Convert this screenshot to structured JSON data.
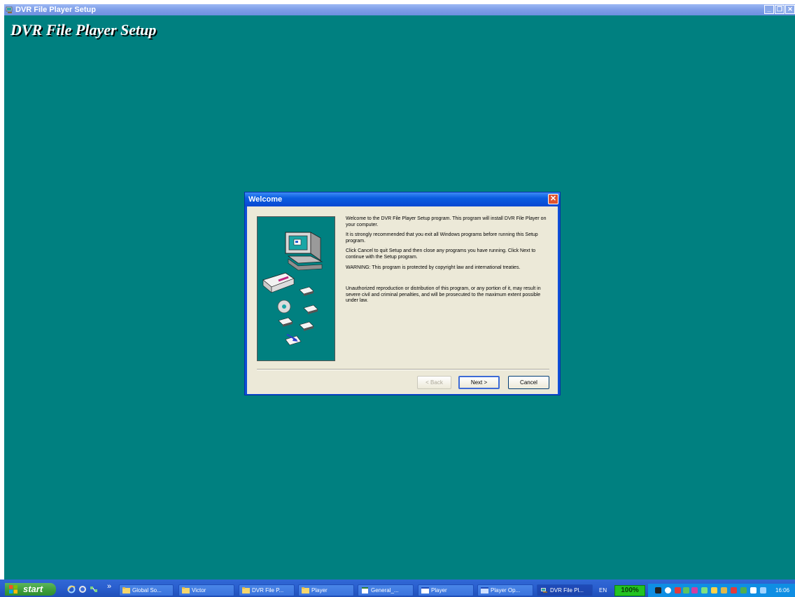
{
  "window": {
    "title": "DVR File Player Setup",
    "heading": "DVR File Player Setup",
    "controls": {
      "minimize": "_",
      "restore": "❐",
      "close": "✕"
    }
  },
  "dialog": {
    "title": "Welcome",
    "close": "✕",
    "paragraphs": [
      "Welcome to the DVR File Player Setup program. This program will install DVR File Player on your computer.",
      "It is strongly recommended that you exit all Windows programs before running this Setup program.",
      "Click Cancel to quit Setup and then close any programs you have running. Click Next to continue with the Setup program.",
      "WARNING: This program is protected by copyright law and international treaties.",
      "Unauthorized reproduction or distribution of this program, or any portion of it, may result in severe civil and criminal penalties, and will be prosecuted to the maximum extent possible under law."
    ],
    "buttons": {
      "back": "< Back",
      "next": "Next >",
      "cancel": "Cancel"
    }
  },
  "taskbar": {
    "start": "start",
    "quick_launch": [
      "ie-icon",
      "firefox-icon",
      "network-icon"
    ],
    "quick_more": "»",
    "tasks": [
      {
        "label": "Global So...",
        "icon": "folder-icon"
      },
      {
        "label": "Victor",
        "icon": "folder-icon"
      },
      {
        "label": "DVR File P...",
        "icon": "folder-icon"
      },
      {
        "label": "Player",
        "icon": "folder-icon"
      },
      {
        "label": "General_...",
        "icon": "document-icon"
      },
      {
        "label": "Player",
        "icon": "app-icon"
      },
      {
        "label": "Player Op...",
        "icon": "app-icon"
      },
      {
        "label": "DVR File Pl...",
        "icon": "setup-icon"
      }
    ],
    "language": "EN",
    "zoom": "100%",
    "clock": "16:06"
  },
  "colors": {
    "desktop": "#008080",
    "xp_blue": "#0a5de0",
    "dialog_face": "#ece9d8",
    "start_green": "#3c9c3a"
  }
}
